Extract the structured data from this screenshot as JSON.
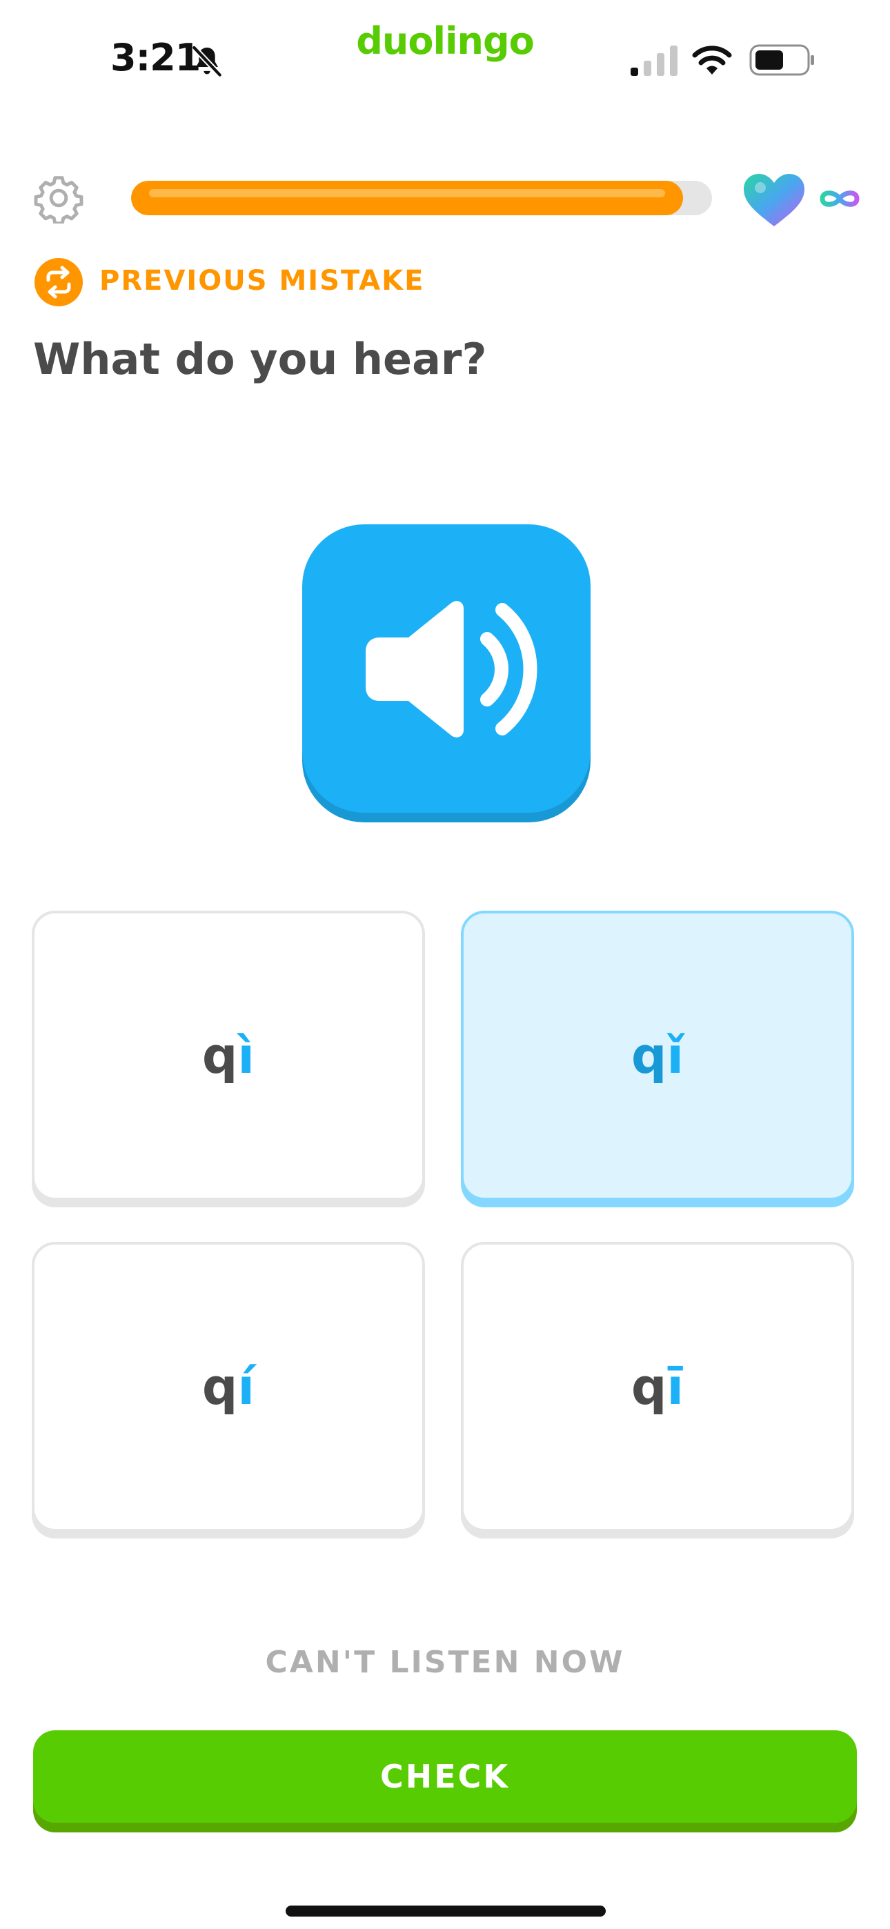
{
  "status_bar": {
    "time": "3:21",
    "app_name": "duolingo",
    "icons": [
      "bell-slash-icon",
      "cellular-signal-icon",
      "wifi-icon",
      "battery-icon"
    ]
  },
  "lesson": {
    "progress": 0.95,
    "hearts": "∞",
    "colors": {
      "accent": "#58cc02",
      "progress": "#ff9600",
      "blue": "#1cb0f6"
    }
  },
  "tag": {
    "label": "PREVIOUS MISTAKE",
    "icon": "repeat-icon"
  },
  "prompt": "What do you hear?",
  "audio": {
    "icon": "speaker-volume-icon"
  },
  "options": [
    {
      "base": "q",
      "accent": "ì",
      "selected": false
    },
    {
      "base": "q",
      "accent": "ǐ",
      "selected": true
    },
    {
      "base": "q",
      "accent": "í",
      "selected": false
    },
    {
      "base": "q",
      "accent": "ī",
      "selected": false
    }
  ],
  "cant_listen_label": "CAN'T LISTEN NOW",
  "check_label": "CHECK"
}
